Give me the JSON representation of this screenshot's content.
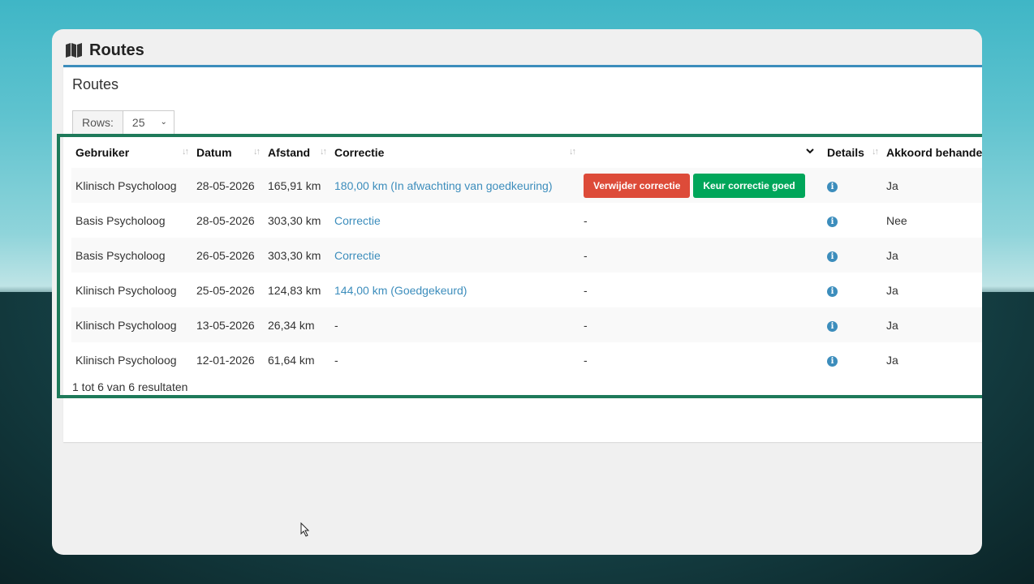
{
  "page": {
    "title": "Routes"
  },
  "card": {
    "title": "Routes"
  },
  "rows": {
    "label": "Rows:",
    "value": "25"
  },
  "columns": {
    "user": "Gebruiker",
    "date": "Datum",
    "distance": "Afstand",
    "correction": "Correctie",
    "details": "Details",
    "approved": "Akkoord behandel"
  },
  "table_rows": [
    {
      "user": "Klinisch Psycholoog",
      "date": "28-05-2026",
      "distance": "165,91 km",
      "correction": "180,00 km (In afwachting van goedkeuring)",
      "action": "",
      "approved": "Ja"
    },
    {
      "user": "Basis Psycholoog",
      "date": "28-05-2026",
      "distance": "303,30 km",
      "correction": "Correctie",
      "action": "-",
      "approved": "Nee"
    },
    {
      "user": "Basis Psycholoog",
      "date": "26-05-2026",
      "distance": "303,30 km",
      "correction": "Correctie",
      "action": "-",
      "approved": "Ja"
    },
    {
      "user": "Klinisch Psycholoog",
      "date": "25-05-2026",
      "distance": "124,83 km",
      "correction": "144,00 km (Goedgekeurd)",
      "action": "-",
      "approved": "Ja"
    },
    {
      "user": "Klinisch Psycholoog",
      "date": "13-05-2026",
      "distance": "26,34 km",
      "correction": "-",
      "action": "-",
      "approved": "Ja"
    },
    {
      "user": "Klinisch Psycholoog",
      "date": "12-01-2026",
      "distance": "61,64 km",
      "correction": "-",
      "action": "-",
      "approved": "Ja"
    }
  ],
  "buttons": {
    "remove": "Verwijder correctie",
    "approve": "Keur correctie goed"
  },
  "footer": {
    "summary": "1 tot 6 van 6 resultaten"
  },
  "colors": {
    "accent": "#3c8dbc",
    "danger": "#dd4b39",
    "success": "#00a65a",
    "highlight": "#1e7a5a"
  },
  "icons": {
    "header": "map-icon",
    "details": "info-circle-icon",
    "sort": "sort-icon"
  }
}
